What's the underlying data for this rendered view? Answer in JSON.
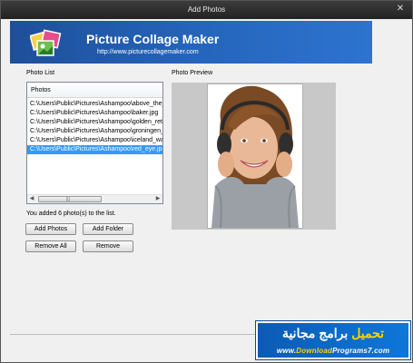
{
  "window": {
    "title": "Add Photos",
    "close_glyph": "✕"
  },
  "banner": {
    "title": "Picture Collage Maker",
    "url": "http://www.picturecollagemaker.com",
    "logo_icon": "collage-photos-icon"
  },
  "photo_list": {
    "label": "Photo List",
    "column_header": "Photos",
    "rows": [
      "C:\\Users\\Public\\Pictures\\Ashampoo\\above_the_",
      "C:\\Users\\Public\\Pictures\\Ashampoo\\baker.jpg",
      "C:\\Users\\Public\\Pictures\\Ashampoo\\golden_retr",
      "C:\\Users\\Public\\Pictures\\Ashampoo\\groningen_",
      "C:\\Users\\Public\\Pictures\\Ashampoo\\iceland_wat",
      "C:\\Users\\Public\\Pictures\\Ashampoo\\red_eye.jpg"
    ],
    "selected_index": 5,
    "status": "You added 6 photo(s) to the list."
  },
  "buttons": {
    "add_photos": "Add Photos",
    "add_folder": "Add Folder",
    "remove_all": "Remove All",
    "remove": "Remove"
  },
  "preview": {
    "label": "Photo Preview",
    "image_icon": "woman-with-headphones-photo"
  },
  "watermark": {
    "arabic_part1": "تحميل",
    "arabic_part2": "برامج مجانية",
    "site_prefix": "www.",
    "site_name": "Download",
    "site_mid": "Programs",
    "site_suffix": "7.com"
  },
  "colors": {
    "banner": "#2566bd",
    "selection": "#3399ff",
    "watermark": "#0e77d8"
  }
}
